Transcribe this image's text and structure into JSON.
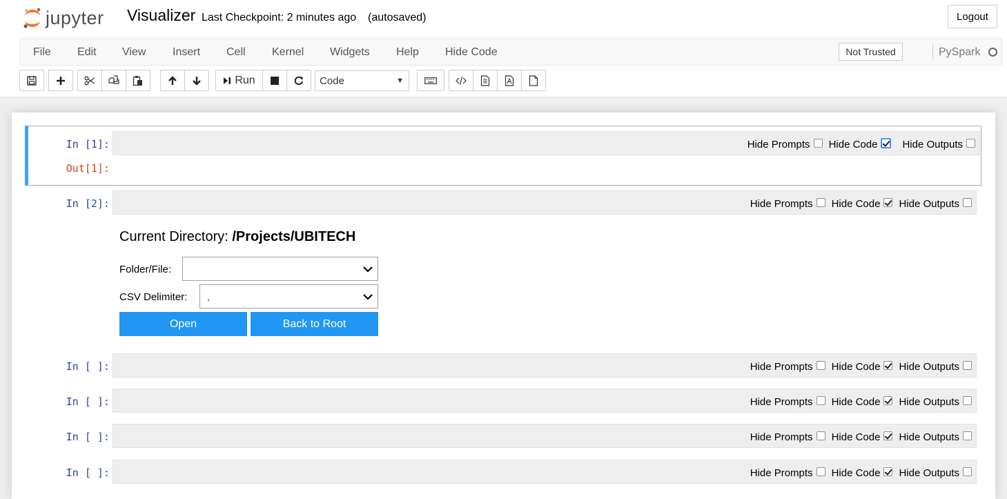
{
  "header": {
    "logo_text": "jupyter",
    "notebook_name": "Visualizer",
    "checkpoint": "Last Checkpoint: 2 minutes ago",
    "autosave": "(autosaved)",
    "logout_label": "Logout"
  },
  "menubar": {
    "items": [
      "File",
      "Edit",
      "View",
      "Insert",
      "Cell",
      "Kernel",
      "Widgets",
      "Help",
      "Hide Code"
    ],
    "trust_label": "Not Trusted",
    "kernel_name": "PySpark"
  },
  "toolbar": {
    "run_label": "Run",
    "cell_type": "Code",
    "icons": [
      "save-icon",
      "plus-icon",
      "cut-icon",
      "copy-icon",
      "paste-icon",
      "arrow-up-icon",
      "arrow-down-icon",
      "run-icon",
      "stop-icon",
      "restart-icon",
      "keyboard-icon",
      "code-icon",
      "html-icon",
      "pdf-icon",
      "file-icon"
    ]
  },
  "toggle_labels": {
    "hide_prompts": "Hide Prompts",
    "hide_code": "Hide Code",
    "hide_outputs": "Hide Outputs"
  },
  "cells": [
    {
      "in_prompt": "In [1]:",
      "out_prompt": "Out[1]:",
      "hide_prompts": false,
      "hide_code": true,
      "hide_outputs": false
    },
    {
      "in_prompt": "In [2]:",
      "hide_prompts": false,
      "hide_code": true,
      "hide_outputs": false
    },
    {
      "in_prompt": "In [ ]:",
      "hide_prompts": false,
      "hide_code": true,
      "hide_outputs": false
    },
    {
      "in_prompt": "In [ ]:",
      "hide_prompts": false,
      "hide_code": true,
      "hide_outputs": false
    },
    {
      "in_prompt": "In [ ]:",
      "hide_prompts": false,
      "hide_code": true,
      "hide_outputs": false
    },
    {
      "in_prompt": "In [ ]:",
      "hide_prompts": false,
      "hide_code": true,
      "hide_outputs": false
    }
  ],
  "widget": {
    "current_dir_label": "Current Directory:",
    "current_dir_value": "/Projects/UBITECH",
    "folder_label": "Folder/File:",
    "folder_value": "",
    "delimiter_label": "CSV Delimiter:",
    "delimiter_value": ",",
    "open_label": "Open",
    "back_label": "Back to Root"
  },
  "colors": {
    "accent": "#42a5f5",
    "button": "#2196f3",
    "in_prompt": "#303f9f",
    "out_prompt": "#d84315",
    "logo_orange": "#f37626"
  }
}
